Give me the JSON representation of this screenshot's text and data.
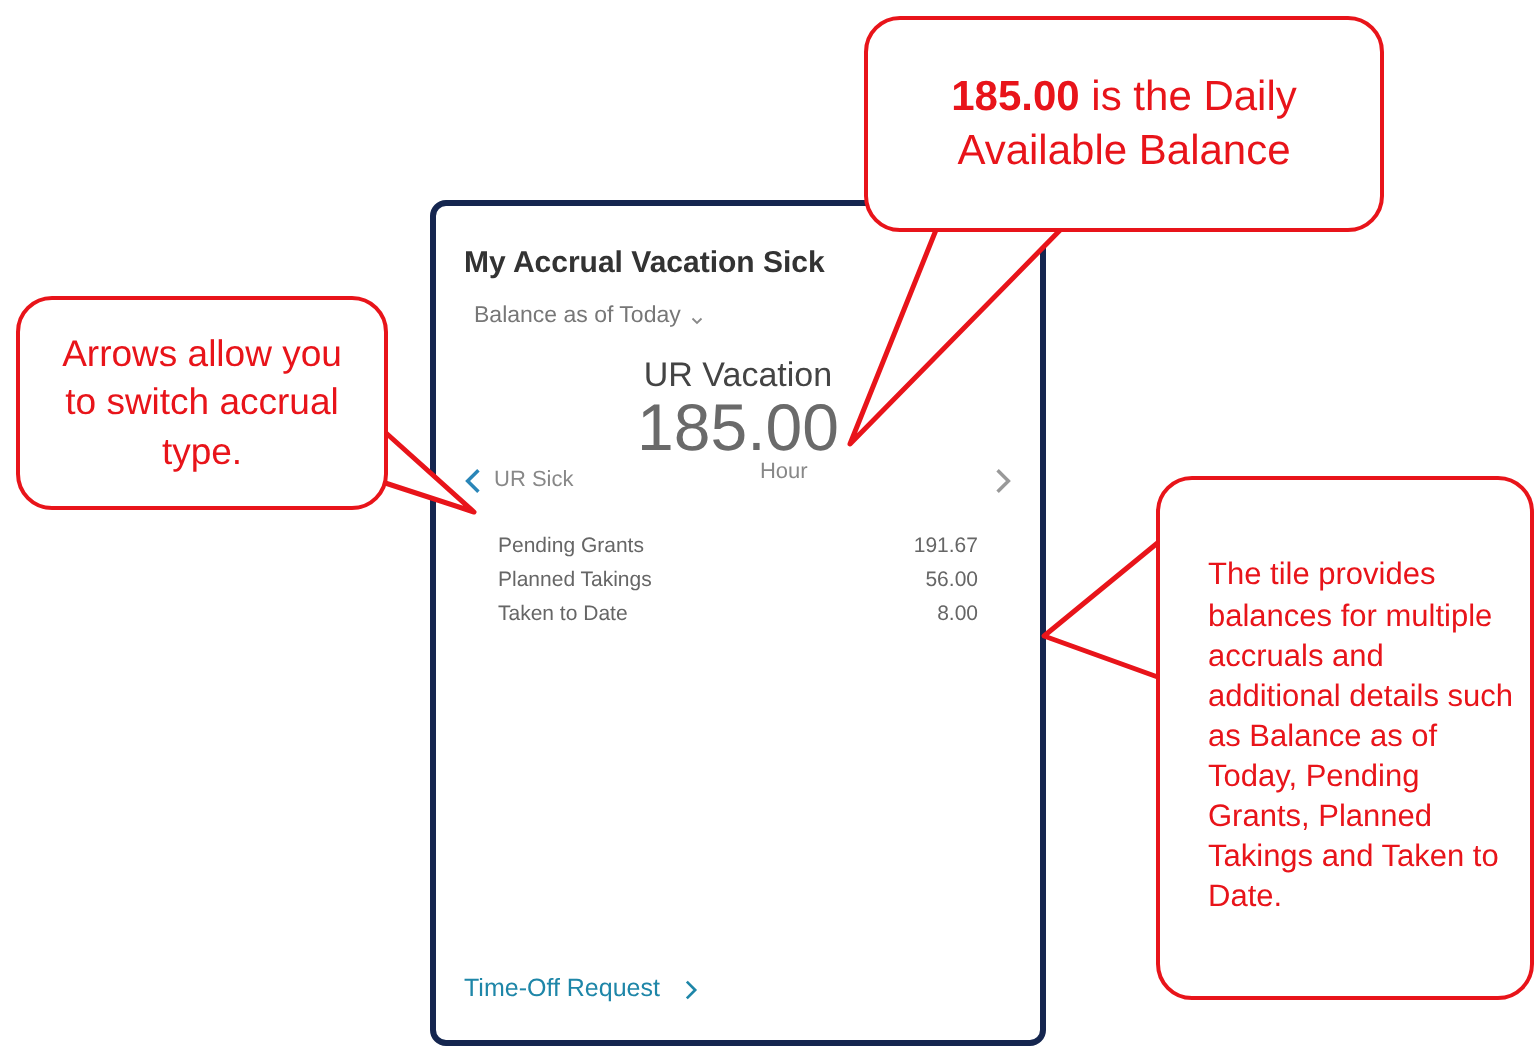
{
  "tile": {
    "title": "My Accrual Vacation Sick",
    "balance_selector": "Balance as of Today",
    "accrual_name": "UR Vacation",
    "balance": "185.00",
    "unit": "Hour",
    "previous_accrual": "UR Sick",
    "details": [
      {
        "label": "Pending Grants",
        "value": "191.67"
      },
      {
        "label": "Planned Takings",
        "value": "56.00"
      },
      {
        "label": "Taken to Date",
        "value": "8.00"
      }
    ],
    "link": "Time-Off Request"
  },
  "callouts": [
    {
      "text": "**185.00** is the Daily Available Balance"
    },
    {
      "text": "Arrows allow you to switch accrual type."
    },
    {
      "text": "The tile provides balances for multiple accruals and additional details such as Balance as of Today, Pending Grants, Planned Takings and Taken to Date."
    }
  ]
}
